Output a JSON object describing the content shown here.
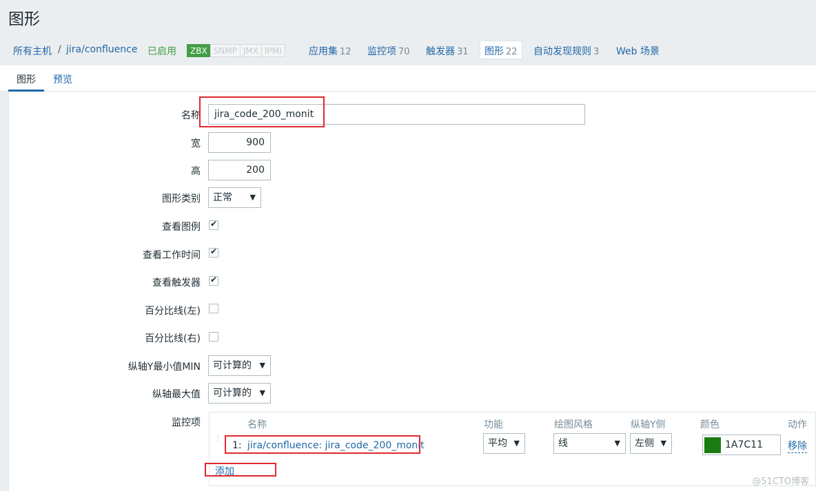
{
  "page": {
    "title": "图形"
  },
  "nav": {
    "breadcrumb_all_hosts": "所有主机",
    "separator": "/",
    "host": "jira/confluence",
    "status": "已启用",
    "badges": [
      "ZBX",
      "SNMP",
      "JMX",
      "IPMI"
    ],
    "tabs": [
      {
        "label": "应用集",
        "count": "12"
      },
      {
        "label": "监控项",
        "count": "70"
      },
      {
        "label": "触发器",
        "count": "31"
      },
      {
        "label": "图形",
        "count": "22"
      },
      {
        "label": "自动发现规则",
        "count": "3"
      },
      {
        "label": "Web 场景",
        "count": ""
      }
    ]
  },
  "form_tabs": {
    "graph": "图形",
    "preview": "预览"
  },
  "form": {
    "name_label": "名称",
    "name_value": "jira_code_200_monit",
    "width_label": "宽",
    "width_value": "900",
    "height_label": "高",
    "height_value": "200",
    "type_label": "图形类别",
    "type_value": "正常",
    "show_legend_label": "查看图例",
    "show_worktime_label": "查看工作时间",
    "show_triggers_label": "查看触发器",
    "percentile_left_label": "百分比线(左)",
    "percentile_right_label": "百分比线(右)",
    "ymin_label": "纵轴Y最小值MIN",
    "ymin_value": "可计算的",
    "ymax_label": "纵轴最大值",
    "ymax_value": "可计算的",
    "items_label": "监控项"
  },
  "items_table": {
    "headers": {
      "name": "名称",
      "function": "功能",
      "draw_style": "绘图风格",
      "y_side": "纵轴Y侧",
      "color": "颜色",
      "action": "动作"
    },
    "rows": [
      {
        "num": "1:",
        "name": "jira/confluence: jira_code_200_monit",
        "function": "平均",
        "draw_style": "线",
        "y_side": "左侧",
        "color": "1A7C11",
        "color_hex": "#1a7c11",
        "action": "移除"
      }
    ],
    "add_label": "添加"
  },
  "watermark": "@51CTO博客",
  "colors": {
    "link": "#1f68a8",
    "enabled": "#429e47",
    "highlight": "#e0282e"
  }
}
